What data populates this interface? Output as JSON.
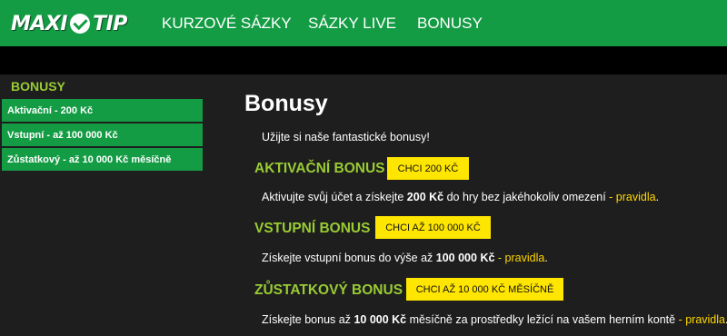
{
  "header": {
    "logo_left": "MAXI",
    "logo_right": "TIP",
    "nav": [
      "KURZOVÉ SÁZKY",
      "SÁZKY LIVE",
      "BONUSY"
    ]
  },
  "sidebar": {
    "title": "BONUSY",
    "items": [
      {
        "label": "Aktivační - 200 Kč"
      },
      {
        "label": "Vstupní - až 100 000 Kč"
      },
      {
        "label": "Zůstatkový - až 10 000 Kč měsíčně"
      }
    ]
  },
  "main": {
    "title": "Bonusy",
    "intro": "Užijte si naše fantastické bonusy!",
    "rules_link": "pravidla",
    "bonuses": [
      {
        "heading": "AKTIVAČNÍ BONUS",
        "button": "CHCI 200 KČ",
        "text_before": "Aktivujte svůj účet a získejte ",
        "text_bold": "200 Kč",
        "text_after": " do hry bez jakéhokoliv omezení "
      },
      {
        "heading": "VSTUPNÍ BONUS",
        "button": "CHCI AŽ 100 000 KČ",
        "text_before": "Získejte vstupní bonus do výše až ",
        "text_bold": "100 000 Kč",
        "text_after": " "
      },
      {
        "heading": "ZŮSTATKOVÝ BONUS",
        "button": "CHCI AŽ 10 000 KČ MĚSÍČNĚ",
        "text_before": "Získejte bonus až ",
        "text_bold": "10 000 Kč",
        "text_after": " měsíčně za prostředky ležící na vašem herním kontě "
      }
    ]
  },
  "colors": {
    "brand_green": "#149c45",
    "accent_green": "#99cc33",
    "button_yellow": "#ffe600",
    "link_yellow": "#ffd700",
    "background": "#1e1e1e"
  }
}
